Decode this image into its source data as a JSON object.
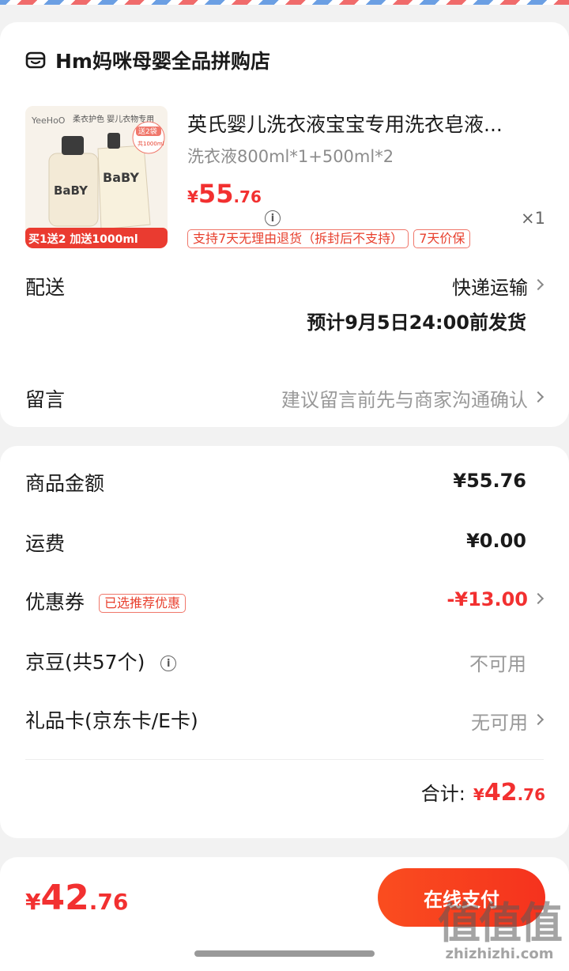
{
  "shop": {
    "name": "Hm妈咪母婴全品拼购店"
  },
  "product": {
    "title": "英氏婴儿洗衣液宝宝专用洗衣皂液...",
    "spec": "洗衣液800ml*1+500ml*2",
    "price_currency": "¥",
    "price_int": "55",
    "price_dec": ".76",
    "quantity": "×1",
    "image": {
      "brand": "YeeHoO",
      "tagline": "柔衣护色 婴儿衣物专用",
      "bottle_text": "BaBY",
      "bonus": "送2袋",
      "bonus_sub": "共1000ml",
      "banner": "买1送2 加送1000ml"
    },
    "tags": [
      "支持7天无理由退货（拆封后不支持）",
      "7天价保"
    ]
  },
  "delivery": {
    "label": "配送",
    "method": "快递运输",
    "estimate": "预计9月5日24:00前发货"
  },
  "remark": {
    "label": "留言",
    "hint": "建议留言前先与商家沟通确认"
  },
  "summary": {
    "goods_label": "商品金额",
    "goods_value": "¥55.76",
    "shipping_label": "运费",
    "shipping_value": "¥0.00",
    "coupon_label": "优惠券",
    "coupon_badge": "已选推荐优惠",
    "coupon_value": "-¥13.00",
    "jd_beans_label": "京豆(共57个)",
    "jd_beans_value": "不可用",
    "gift_card_label": "礼品卡(京东卡/E卡)",
    "gift_card_value": "无可用",
    "total_label": "合计:",
    "total_currency": "¥",
    "total_int": "42",
    "total_dec": ".76"
  },
  "bottom": {
    "currency": "¥",
    "int": "42",
    "dec": ".76",
    "pay_label": "在线支付"
  },
  "watermark": {
    "big": "值值值",
    "small": "zhizhizhi.com"
  },
  "colors": {
    "accent": "#f23030",
    "button": "#f5321e",
    "background": "#f2f2f2"
  }
}
